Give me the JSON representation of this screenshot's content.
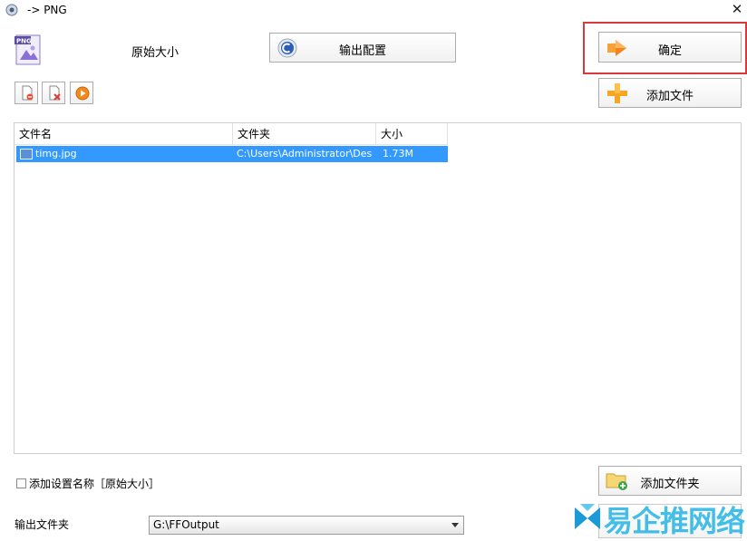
{
  "window": {
    "title": "-> PNG"
  },
  "format": {
    "size_label": "原始大小"
  },
  "buttons": {
    "config": "输出配置",
    "ok": "确定",
    "add_file": "添加文件",
    "add_folder": "添加文件夹"
  },
  "file_list": {
    "columns": [
      "文件名",
      "文件夹",
      "大小"
    ],
    "rows": [
      {
        "name": "timg.jpg",
        "folder": "C:\\Users\\Administrator\\Des...",
        "size": "1.73M"
      }
    ]
  },
  "options": {
    "add_setting_name_label": "添加设置名称［原始大小］",
    "add_setting_name_checked": false
  },
  "output": {
    "label": "输出文件夹",
    "folder_value": "G:\\FFOutput"
  },
  "watermark": {
    "text": "易企推网络"
  },
  "colors": {
    "selection": "#3399ff",
    "highlight_frame": "#d9393b"
  }
}
